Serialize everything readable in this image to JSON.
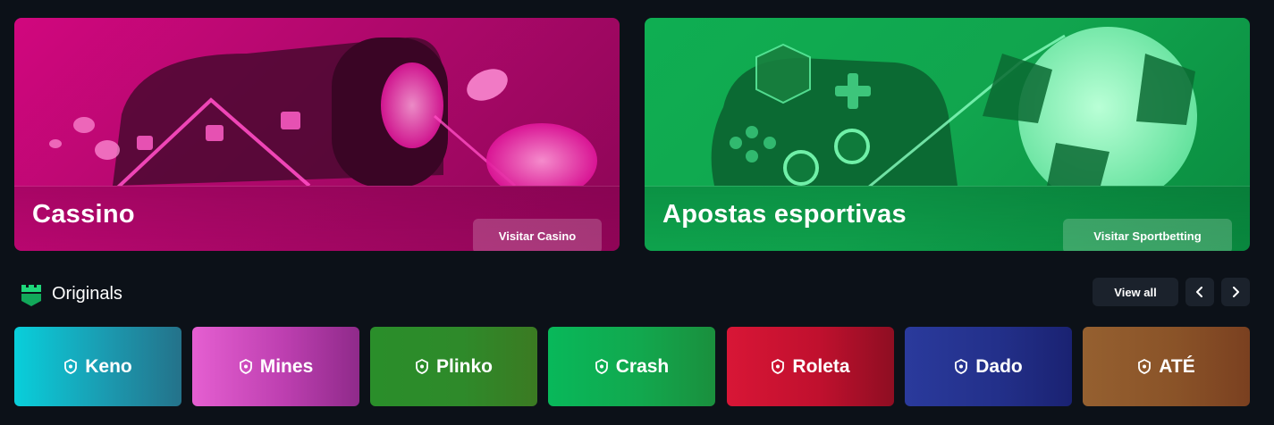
{
  "banners": {
    "casino": {
      "title": "Cassino",
      "button": "Visitar Casino"
    },
    "sports": {
      "title": "Apostas esportivas",
      "button": "Visitar Sportbetting"
    }
  },
  "originals": {
    "title": "Originals",
    "view_all": "View all",
    "prev_icon": "chevron-left-icon",
    "next_icon": "chevron-right-icon"
  },
  "games": [
    {
      "label": "Keno",
      "color": "#14b8c4"
    },
    {
      "label": "Mines",
      "color": "#c63cb4"
    },
    {
      "label": "Plinko",
      "color": "#2e8a2a"
    },
    {
      "label": "Crash",
      "color": "#12a84e"
    },
    {
      "label": "Roleta",
      "color": "#c0102e"
    },
    {
      "label": "Dado",
      "color": "#23308a"
    },
    {
      "label": "ATÉ",
      "color": "#8a5328"
    }
  ],
  "colors": {
    "background": "#0c1118",
    "casino": "#c4077a",
    "sports": "#10a84f",
    "accent": "#1fd67a"
  }
}
